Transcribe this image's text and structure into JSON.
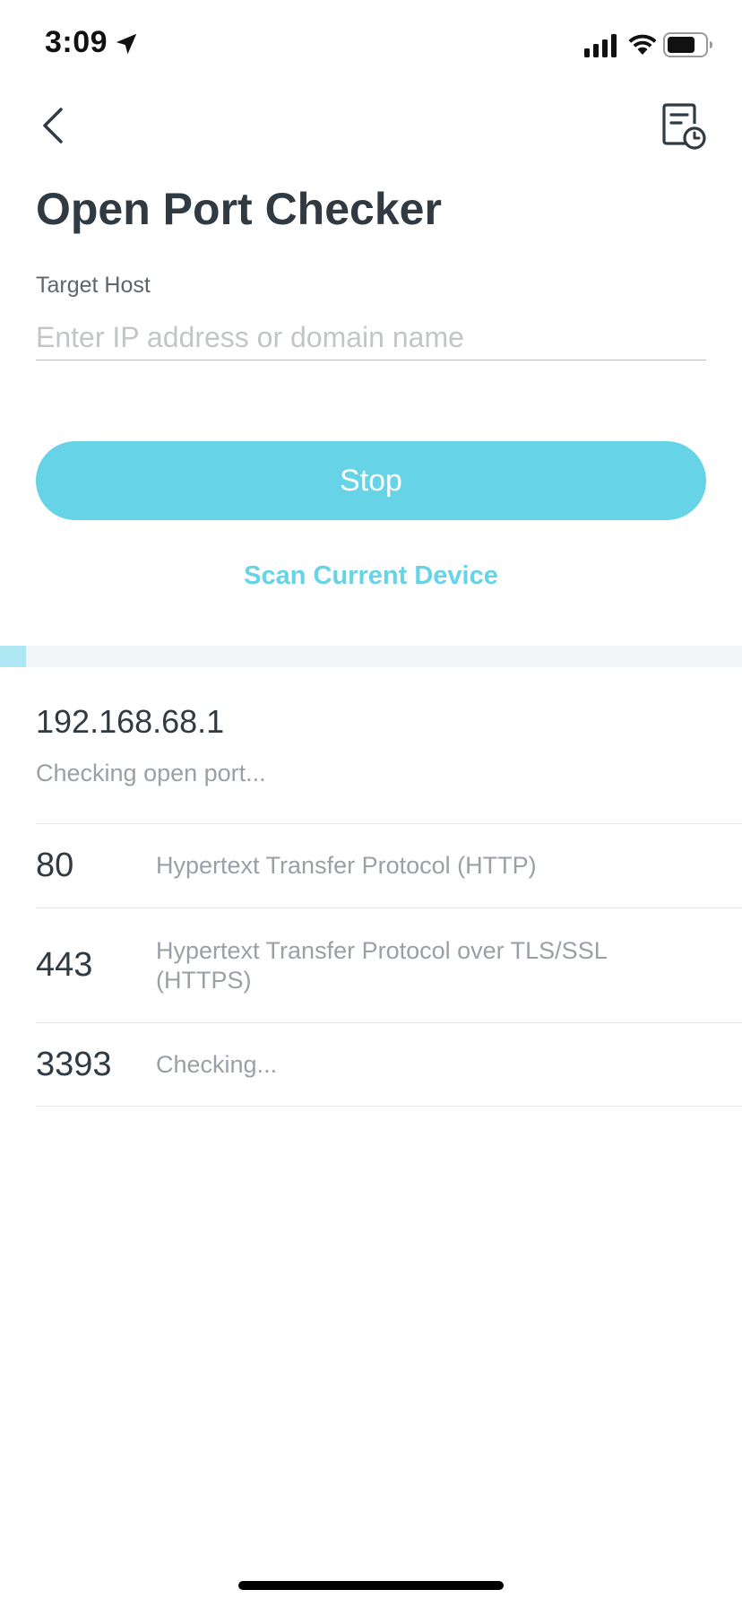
{
  "status_bar": {
    "time": "3:09",
    "icons": [
      "location-arrow-icon",
      "cellular-signal-icon",
      "wifi-icon",
      "battery-icon"
    ]
  },
  "nav": {
    "back_icon": "chevron-left-icon",
    "history_icon": "history-report-icon"
  },
  "page": {
    "title": "Open Port Checker"
  },
  "form": {
    "label": "Target Host",
    "value": "",
    "placeholder": "Enter IP address or domain name"
  },
  "actions": {
    "stop_label": "Stop",
    "scan_current_label": "Scan Current Device"
  },
  "progress": {
    "fraction": 0.035
  },
  "result": {
    "host": "192.168.68.1",
    "status": "Checking open port...",
    "ports": [
      {
        "port": "80",
        "service": "Hypertext Transfer Protocol (HTTP)"
      },
      {
        "port": "443",
        "service": "Hypertext Transfer Protocol over TLS/SSL (HTTPS)"
      },
      {
        "port": "3393",
        "service": "Checking..."
      }
    ]
  },
  "colors": {
    "accent": "#66d3e6",
    "progress_fill": "#aee7f1",
    "title_text": "#2f3a43",
    "muted_text": "#9aa0a6"
  }
}
